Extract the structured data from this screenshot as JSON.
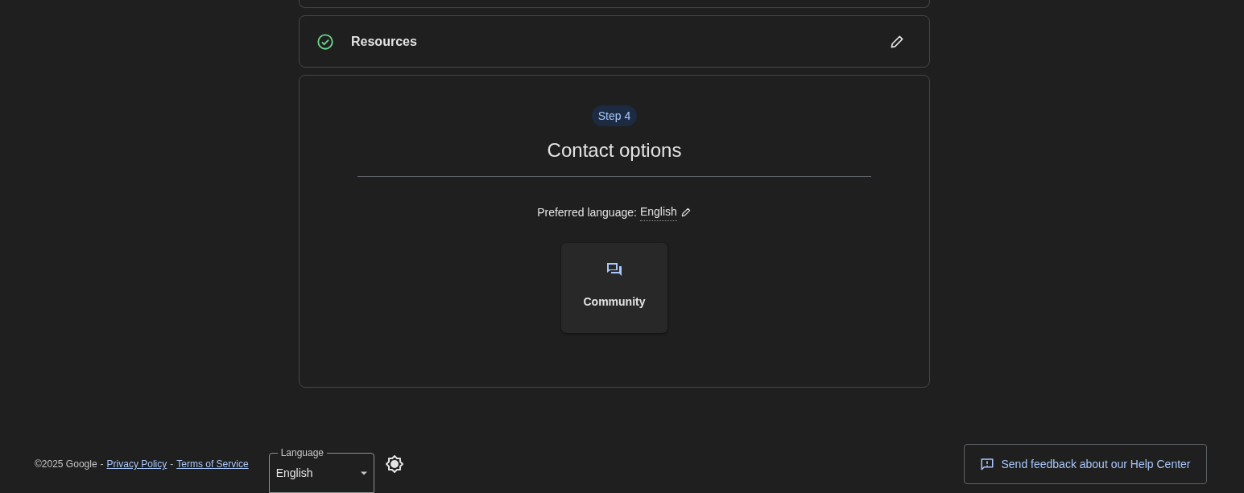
{
  "steps": [
    {
      "title": "Resources",
      "completed": true
    }
  ],
  "current_step": {
    "badge": "Step 4",
    "title": "Contact options",
    "language_label": "Preferred language:",
    "language_value": "English",
    "options": [
      {
        "label": "Community"
      }
    ]
  },
  "footer": {
    "copyright": "©2025 Google",
    "separator": "-",
    "links": [
      "Privacy Policy",
      "Terms of Service"
    ],
    "language": {
      "label": "Language",
      "value": "English"
    },
    "feedback": "Send feedback about our Help Center"
  }
}
